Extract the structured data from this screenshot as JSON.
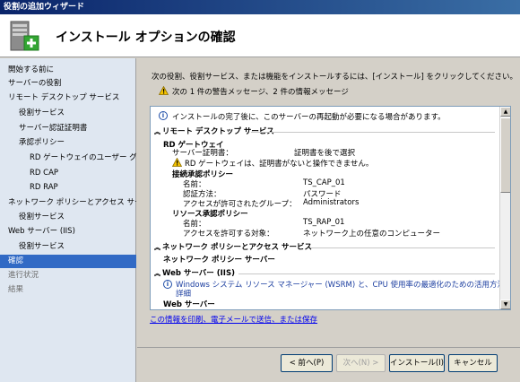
{
  "window": {
    "title": "役割の追加ウィザード"
  },
  "header": {
    "title": "インストール オプションの確認",
    "icon": "server-add-icon"
  },
  "nav": {
    "items": [
      {
        "label": "開始する前に",
        "state": "normal"
      },
      {
        "label": "サーバーの役割",
        "state": "normal"
      },
      {
        "label": "リモート デスクトップ サービス",
        "state": "normal"
      },
      {
        "label": "役割サービス",
        "state": "normal"
      },
      {
        "label": "サーバー認証証明書",
        "state": "normal"
      },
      {
        "label": "承認ポリシー",
        "state": "normal"
      },
      {
        "label": "RD ゲートウェイのユーザー グ...",
        "state": "normal"
      },
      {
        "label": "RD CAP",
        "state": "normal"
      },
      {
        "label": "RD RAP",
        "state": "normal"
      },
      {
        "label": "ネットワーク ポリシーとアクセス サービ...",
        "state": "normal"
      },
      {
        "label": "役割サービス",
        "state": "normal"
      },
      {
        "label": "Web サーバー (IIS)",
        "state": "normal"
      },
      {
        "label": "役割サービス",
        "state": "normal"
      },
      {
        "label": "確認",
        "state": "selected"
      },
      {
        "label": "進行状況",
        "state": "dim"
      },
      {
        "label": "結果",
        "state": "dim"
      }
    ]
  },
  "main": {
    "instruction": "次の役割、役割サービス、または機能をインストールするには、[インストール] をクリックしてください。",
    "warning_summary": "次の 1 件の警告メッセージ、2 件の情報メッセージ",
    "restart_note": "インストールの完了後に、このサーバーの再起動が必要になる場合があります。",
    "sections": {
      "rds": {
        "title": "リモート デスクトップ サービス"
      },
      "rdg": {
        "title": "RD ゲートウェイ",
        "cert_label": "サーバー証明書：",
        "cert_value": "証明書を後で選択",
        "cert_warning": "RD ゲートウェイは、証明書がないと操作できません。"
      },
      "cap": {
        "title": "接続承認ポリシー",
        "name_label": "名前：",
        "name_value": "TS_CAP_01",
        "auth_label": "認証方法：",
        "auth_value": "パスワード",
        "group_label": "アクセスが許可されたグループ：",
        "group_value": "Administrators"
      },
      "rap": {
        "title": "リソース承認ポリシー",
        "name_label": "名前：",
        "name_value": "TS_RAP_01",
        "allow_label": "アクセスを許可する対象：",
        "allow_value": "ネットワーク上の任意のコンピューター"
      },
      "nps": {
        "title": "ネットワーク ポリシーとアクセス サービス",
        "sub": "ネットワーク ポリシー サーバー"
      },
      "iis": {
        "title": "Web サーバー (IIS)",
        "info_line1": "Windows システム リソース マネージャー (WSRM) と、CPU 使用率の最適化のための活用方法の",
        "info_line2": "詳細",
        "sub": "Web サーバー"
      }
    },
    "link": "この情報を印刷、電子メールで送信、または保存"
  },
  "buttons": {
    "back": "< 前へ(P)",
    "next": "次へ(N) >",
    "install": "インストール(I)",
    "cancel": "キャンセル"
  },
  "colors": {
    "selected": "#316ac5",
    "nav_bg": "#dfe7f1",
    "title_bar": "#0a246a"
  }
}
